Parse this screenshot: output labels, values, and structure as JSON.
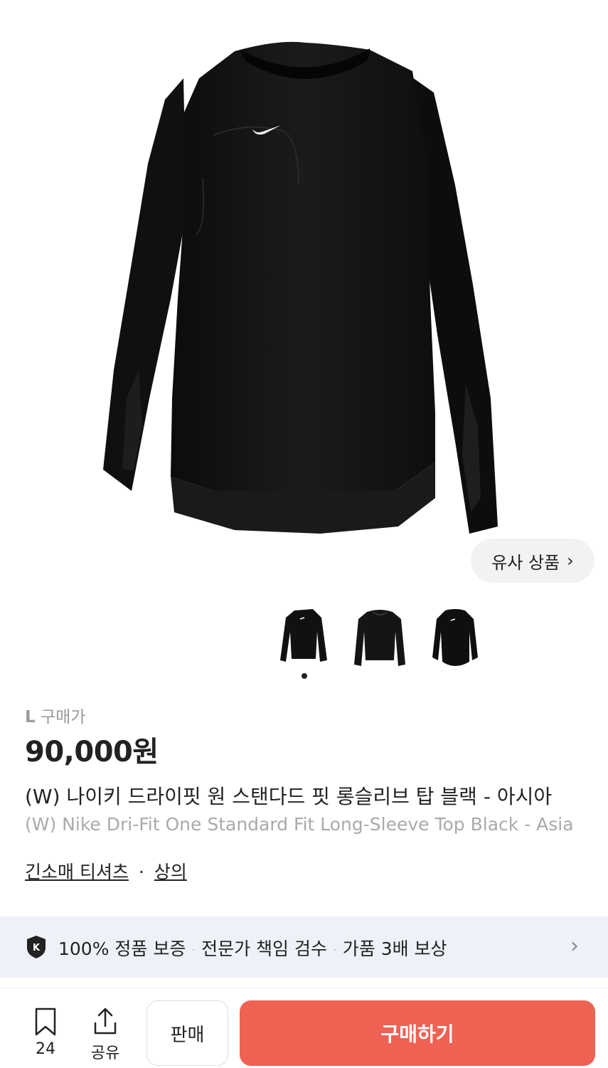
{
  "product": {
    "size": "L",
    "price_type": "구매가",
    "price": "90,000원",
    "title_ko": "(W) 나이키 드라이핏 원 스탠다드 핏 롱슬리브 탑 블랙 - 아시아",
    "title_en": "(W) Nike Dri-Fit One Standard Fit Long-Sleeve Top Black - Asia"
  },
  "similar_button": {
    "label": "유사 상품",
    "chevron": "›"
  },
  "gallery": {
    "thumbnail_count": 3,
    "active_index": 0
  },
  "categories": {
    "primary": "긴소매 티셔츠",
    "separator": "·",
    "secondary": "상의"
  },
  "guarantee_banner": {
    "item1": "100% 정품 보증",
    "item2": "전문가 책임 검수",
    "item3": "가품 3배 보상",
    "separator": "·",
    "chevron": "›"
  },
  "bottom_bar": {
    "bookmark_count": "24",
    "share_label": "공유",
    "sell_label": "판매",
    "buy_label": "구매하기"
  },
  "colors": {
    "buy_button": "#ef6253",
    "banner_bg": "#eef2f8",
    "product": "#111111"
  }
}
